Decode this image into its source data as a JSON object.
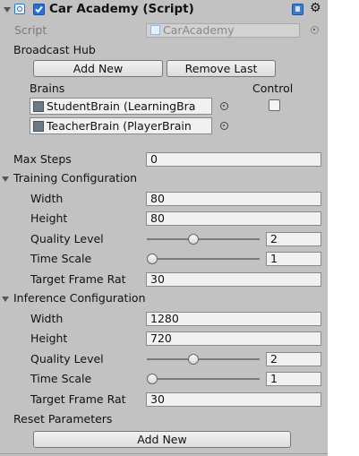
{
  "component": {
    "title": "Car Academy (Script)",
    "script_label": "Script",
    "script_value": "CarAcademy"
  },
  "broadcast_hub": {
    "label": "Broadcast Hub",
    "add_new_label": "Add New",
    "remove_last_label": "Remove Last",
    "brains_header": "Brains",
    "control_header": "Control",
    "brains": [
      {
        "name": "StudentBrain (LearningBra",
        "control": false
      },
      {
        "name": "TeacherBrain (PlayerBrain",
        "control": null
      }
    ]
  },
  "max_steps": {
    "label": "Max Steps",
    "value": "0"
  },
  "training": {
    "title": "Training Configuration",
    "width_label": "Width",
    "width": "80",
    "height_label": "Height",
    "height": "80",
    "quality_label": "Quality Level",
    "quality": "2",
    "quality_fraction": 0.4,
    "timescale_label": "Time Scale",
    "timescale": "1",
    "timescale_fraction": 0.0,
    "fps_label": "Target Frame Rat",
    "fps": "30"
  },
  "inference": {
    "title": "Inference Configuration",
    "width_label": "Width",
    "width": "1280",
    "height_label": "Height",
    "height": "720",
    "quality_label": "Quality Level",
    "quality": "2",
    "quality_fraction": 0.4,
    "timescale_label": "Time Scale",
    "timescale": "1",
    "timescale_fraction": 0.0,
    "fps_label": "Target Frame Rat",
    "fps": "30"
  },
  "reset_parameters": {
    "label": "Reset Parameters",
    "add_new_label": "Add New"
  },
  "colors": {
    "panel": "#c2c2c2",
    "field": "#f1f1f1",
    "script_icon": "#2b77c5",
    "checkbox": "#2a6fd6"
  },
  "icons": {
    "foldout": "triangle-down-icon",
    "script_icon": "csharp-script-icon",
    "help": "help-book-icon",
    "settings": "gear-icon",
    "object_picker": "object-picker-icon",
    "brain_asset": "brain-asset-icon"
  }
}
